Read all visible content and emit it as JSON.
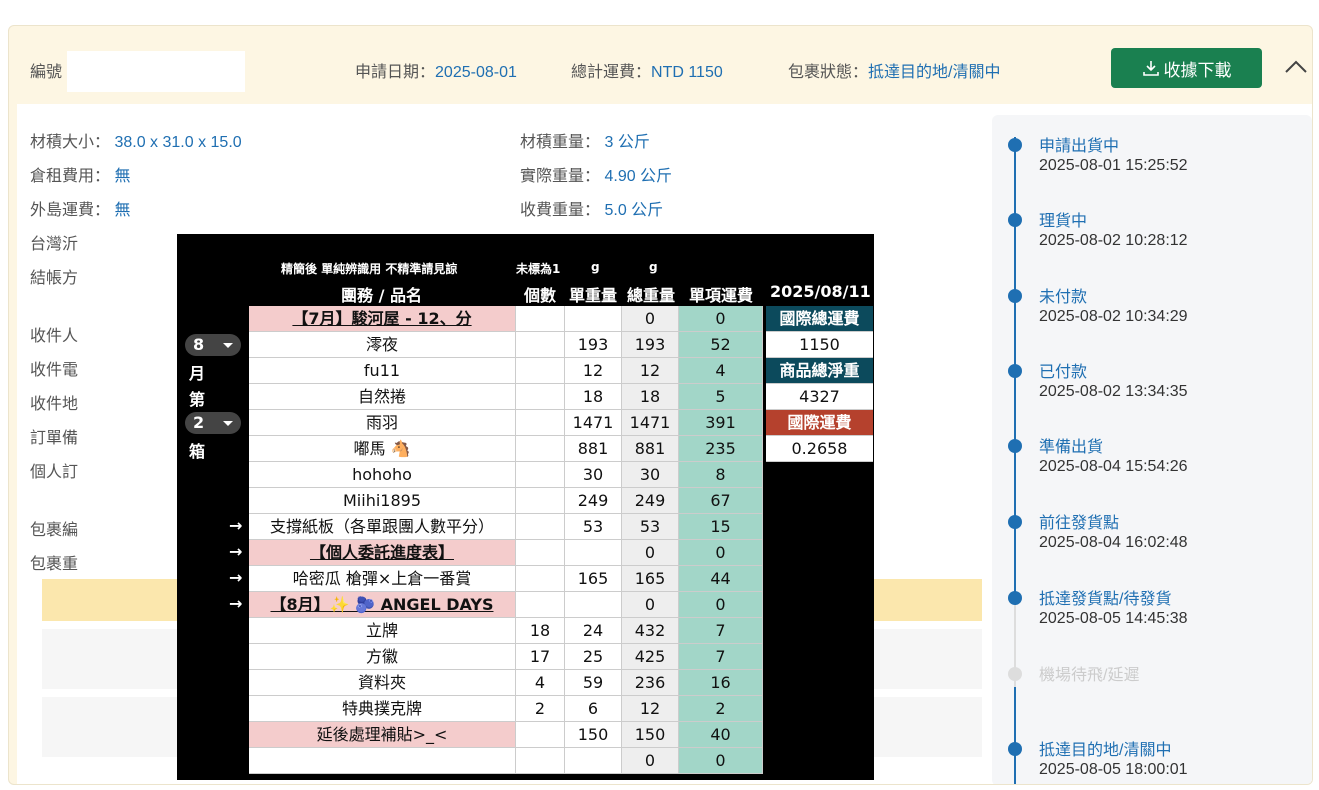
{
  "header": {
    "id_label": "編號",
    "apply_date_label": "申請日期：",
    "apply_date": "2025-08-01",
    "total_fee_label": "總計運費：",
    "total_fee": "NTD 1150",
    "status_label": "包裹狀態：",
    "status": "抵達目的地/清關中",
    "download_label": "收據下載"
  },
  "info": {
    "volume_label": "材積大小：",
    "volume": "38.0 x 31.0 x 15.0",
    "storage_label": "倉租費用：",
    "storage": "無",
    "island_label": "外島運費：",
    "island": "無",
    "taiwan_label": "台灣沂",
    "billing_label": "結帳方",
    "vol_weight_label": "材積重量：",
    "vol_weight": "3 公斤",
    "real_weight_label": "實際重量：",
    "real_weight": "4.90 公斤",
    "charge_weight_label": "收費重量：",
    "charge_weight": "5.0 公斤",
    "recv1": "收件人",
    "recv2": "收件電",
    "recv3": "收件地",
    "order": "訂單備",
    "personal": "個人訂",
    "pkg1": "包裹編",
    "pkg2": "包裹重"
  },
  "timeline": [
    {
      "title": "申請出貨中",
      "time": "2025-08-01 15:25:52"
    },
    {
      "title": "理貨中",
      "time": "2025-08-02 10:28:12"
    },
    {
      "title": "未付款",
      "time": "2025-08-02 10:34:29"
    },
    {
      "title": "已付款",
      "time": "2025-08-02 13:34:35"
    },
    {
      "title": "準備出貨",
      "time": "2025-08-04 15:54:26"
    },
    {
      "title": "前往發貨點",
      "time": "2025-08-04 16:02:48"
    },
    {
      "title": "抵達發貨點/待發貨",
      "time": "2025-08-05 14:45:38"
    },
    {
      "title": "機場待飛/延遲",
      "time": ""
    },
    {
      "title": "抵達目的地/清關中",
      "time": "2025-08-05 18:00:01"
    }
  ],
  "sheet": {
    "note": "精簡後 單純辨識用 不精準請見諒",
    "unmarked": "未標為1",
    "g1": "g",
    "g2": "g",
    "col_name": "團務 / 品名",
    "col_count": "個數",
    "col_unit": "單重量",
    "col_total": "總重量",
    "col_fee": "單項運費",
    "date": "2025/08/11",
    "month_val": "8",
    "month_ch": "月",
    "di": "第",
    "box_val": "2",
    "box_ch": "箱",
    "arrow": "→",
    "rows": [
      {
        "name": "【7月】駿河屋 - 12、分",
        "count": "",
        "unit": "",
        "total": "0",
        "fee": "0",
        "pink": true
      },
      {
        "name": "澪夜",
        "count": "",
        "unit": "193",
        "total": "193",
        "fee": "52"
      },
      {
        "name": "fu11",
        "count": "",
        "unit": "12",
        "total": "12",
        "fee": "4"
      },
      {
        "name": "自然捲",
        "count": "",
        "unit": "18",
        "total": "18",
        "fee": "5"
      },
      {
        "name": "雨羽",
        "count": "",
        "unit": "1471",
        "total": "1471",
        "fee": "391"
      },
      {
        "name": "嘟馬 🐴",
        "count": "",
        "unit": "881",
        "total": "881",
        "fee": "235"
      },
      {
        "name": "hohoho",
        "count": "",
        "unit": "30",
        "total": "30",
        "fee": "8"
      },
      {
        "name": "Miihi1895",
        "count": "",
        "unit": "249",
        "total": "249",
        "fee": "67"
      },
      {
        "name": "支撐紙板（各單跟團人數平分）",
        "count": "",
        "unit": "53",
        "total": "53",
        "fee": "15"
      },
      {
        "name": "【個人委託進度表】",
        "count": "",
        "unit": "",
        "total": "0",
        "fee": "0",
        "pink": true
      },
      {
        "name": "哈密瓜 槍彈×上倉一番賞",
        "count": "",
        "unit": "165",
        "total": "165",
        "fee": "44"
      },
      {
        "name": "【8月】✨ 🫐 ANGEL DAYS",
        "count": "",
        "unit": "",
        "total": "0",
        "fee": "0",
        "pink": true
      },
      {
        "name": "立牌",
        "count": "18",
        "unit": "24",
        "total": "432",
        "fee": "7"
      },
      {
        "name": "方徽",
        "count": "17",
        "unit": "25",
        "total": "425",
        "fee": "7"
      },
      {
        "name": "資料夾",
        "count": "4",
        "unit": "59",
        "total": "236",
        "fee": "16"
      },
      {
        "name": "特典撲克牌",
        "count": "2",
        "unit": "6",
        "total": "12",
        "fee": "2"
      },
      {
        "name": "延後處理補貼>_<",
        "count": "",
        "unit": "150",
        "total": "150",
        "fee": "40",
        "pinkbg": true
      },
      {
        "name": "",
        "count": "",
        "unit": "",
        "total": "0",
        "fee": "0"
      }
    ],
    "intl_label": "國際總運費",
    "intl_value": "1150",
    "net_label": "商品總淨重",
    "net_value": "4327",
    "rate_label": "國際運費",
    "rate_value": "0.2658",
    "colors": {
      "teal": "#0c4a5c",
      "red": "#b5412d",
      "pink": "#f4cccc",
      "mint": "#a2d6c8"
    }
  }
}
